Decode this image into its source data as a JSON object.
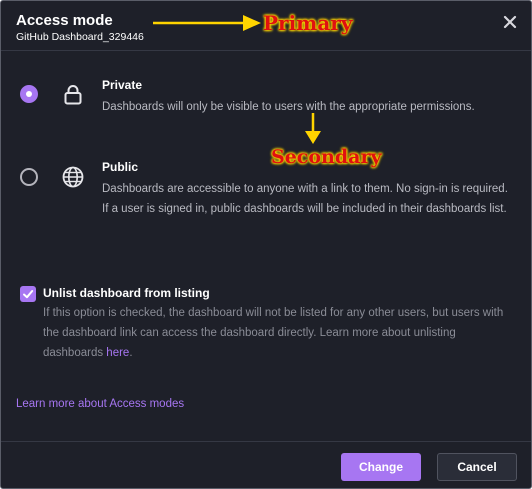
{
  "dialog": {
    "title": "Access mode",
    "subtitle": "GitHub Dashboard_329446",
    "close_icon": "close-icon"
  },
  "annotations": {
    "primary": "Primary",
    "secondary": "Secondary"
  },
  "options": [
    {
      "key": "private",
      "title": "Private",
      "description": "Dashboards will only be visible to users with the appropriate permissions.",
      "icon": "lock-icon",
      "selected": true
    },
    {
      "key": "public",
      "title": "Public",
      "description": "Dashboards are accessible to anyone with a link to them. No sign-in is required. If a user is signed in, public dashboards will be included in their dashboards list.",
      "icon": "globe-icon",
      "selected": false
    }
  ],
  "unlist": {
    "checked": true,
    "label": "Unlist dashboard from listing",
    "description": "If this option is checked, the dashboard will not be listed for any other users, but users with the dashboard link can access the dashboard directly. Learn more about unlisting dashboards ",
    "link_text": "here",
    "after_link": "."
  },
  "learn_more": "Learn more about Access modes",
  "footer": {
    "change_label": "Change",
    "cancel_label": "Cancel"
  },
  "colors": {
    "background": "#1e2029",
    "accent": "#a776f2",
    "annotation_text": "#e01010",
    "annotation_arrow": "#ffd400"
  }
}
